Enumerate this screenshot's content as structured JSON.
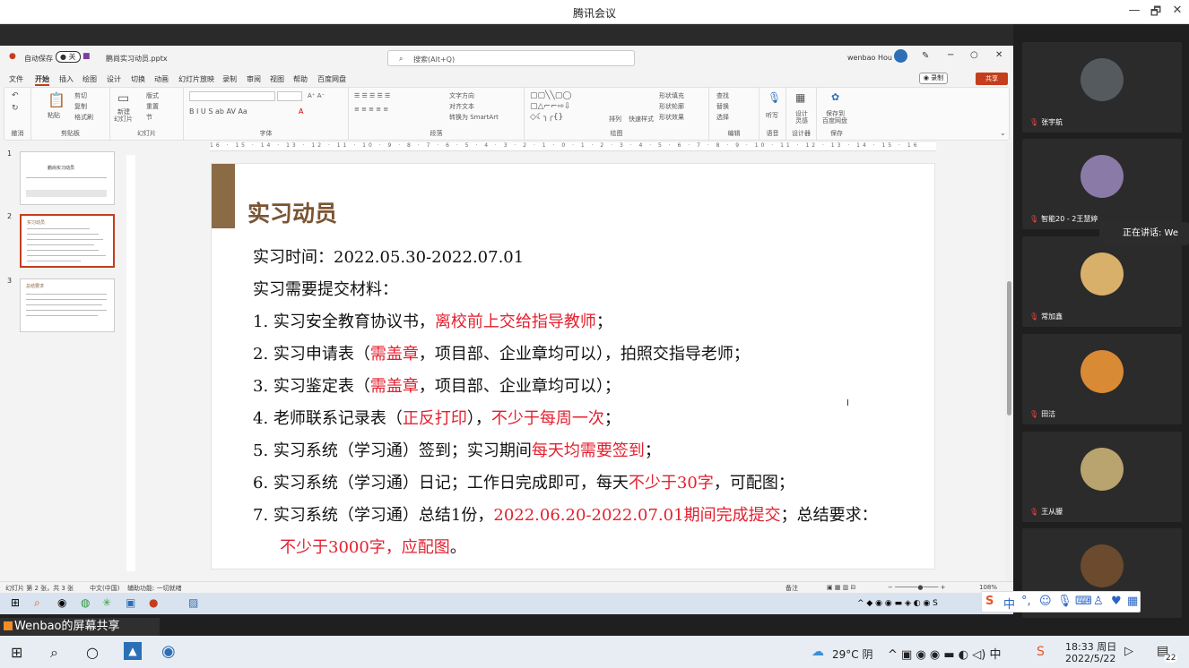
{
  "window": {
    "title": "腾讯会议",
    "minimize": "—",
    "restore": "🗗",
    "close": "✕"
  },
  "ppt": {
    "autosave_label": "自动保存",
    "autosave_state": "关",
    "filename": "鹏尚实习动员.pptx",
    "search_placeholder": "搜索(Alt+Q)",
    "user": "wenbao Hou",
    "record": "◉ 录制",
    "share": "共享",
    "menu": [
      "文件",
      "开始",
      "插入",
      "绘图",
      "设计",
      "切换",
      "动画",
      "幻灯片放映",
      "录制",
      "审阅",
      "视图",
      "帮助",
      "百度网盘"
    ],
    "ribbon": {
      "undo_label": "撤消",
      "clipboard_label": "剪贴板",
      "paste": "粘贴",
      "cut": "剪切",
      "copy": "复制",
      "format_painter": "格式刷",
      "slides_label": "幻灯片",
      "new_slide": "新建",
      "new_slide2": "幻灯片",
      "layout": "版式",
      "reset": "重置",
      "section": "节",
      "font_label": "字体",
      "paragraph_label": "段落",
      "text_direction": "文字方向",
      "align_text": "对齐文本",
      "smartart": "转换为 SmartArt",
      "drawing_label": "绘图",
      "arrange": "排列",
      "quick_styles": "快速样式",
      "shape_fill": "形状填充",
      "shape_outline": "形状轮廓",
      "shape_effects": "形状效果",
      "editing_label": "编辑",
      "find": "查找",
      "replace": "替换",
      "select": "选择",
      "voice_label": "语音",
      "dictate": "听写",
      "designer_label": "设计器",
      "design_ideas": "设计",
      "design_ideas2": "灵感",
      "save_label": "保存",
      "save_baidu": "保存到",
      "save_baidu2": "百度网盘"
    },
    "ruler_text": "16 · 15 · 14 · 13 · 12 · 11 · 10 · 9 · 8 · 7 · 6 · 5 · 4 · 3 · 2 · 1 · 0 · 1 · 2 · 3 · 4 · 5 · 6 · 7 · 8 · 9 · 10 · 11 · 12 · 13 · 14 · 15 · 16",
    "thumbnails": [
      {
        "num": "1",
        "title": "鹏尚实习动员"
      },
      {
        "num": "2",
        "title": "实习动员"
      },
      {
        "num": "3",
        "title": "总结要求"
      }
    ],
    "slide": {
      "title": "实习动员",
      "time": "实习时间：2022.05.30-2022.07.01",
      "materials": "实习需要提交材料：",
      "items": [
        {
          "n": "1.",
          "a": "实习安全教育协议书，",
          "r1": "离校前上交给指导教师",
          "b": "；"
        },
        {
          "n": "2.",
          "a": "实习申请表（",
          "r1": "需盖章",
          "b": "，项目部、企业章均可以），拍照交指导老师；"
        },
        {
          "n": "3.",
          "a": "实习鉴定表（",
          "r1": "需盖章",
          "b": "，项目部、企业章均可以）；"
        },
        {
          "n": "4.",
          "a": "老师联系记录表（",
          "r1": "正反打印",
          "b": "），",
          "r2": "不少于每周一次",
          "c": "；"
        },
        {
          "n": "5.",
          "a": "实习系统（学习通）签到；实习期间",
          "r1": "每天均需要签到",
          "b": "；"
        },
        {
          "n": "6.",
          "a": "实习系统（学习通）日记；工作日完成即可，每天",
          "r1": "不少于30字",
          "b": "，可配图；"
        },
        {
          "n": "7.",
          "a": "实习系统（学习通）总结1份，",
          "r1": "2022.06.20-2022.07.01期间完成提交",
          "b": "；总结要求："
        }
      ],
      "last_line_red": "不少于3000字，应配图",
      "last_line_end": "。"
    },
    "status": {
      "slide_info": "幻灯片 第 2 张，共 3 张",
      "language": "中文(中国)",
      "accessibility": "辅助功能: 一切就绪",
      "notes": "备注",
      "zoom": "108%"
    }
  },
  "screen_share_label": "Wenbao的屏幕共享",
  "speaking": "正在讲话: We",
  "participants": [
    {
      "name": "张宇航",
      "color": "#555a5f"
    },
    {
      "name": "智能20 - 2王慧婷",
      "color": "#8a7aa8"
    },
    {
      "name": "常加鑫",
      "color": "#d9b06a"
    },
    {
      "name": "田洁",
      "color": "#d98a35"
    },
    {
      "name": "王从朦",
      "color": "#b9a36e"
    },
    {
      "name": "",
      "color": "#6b4a2e"
    }
  ],
  "taskbar": {
    "weather": "29°C 阴",
    "time": "18:33 周日",
    "date": "2022/5/22",
    "notifications": "22"
  }
}
